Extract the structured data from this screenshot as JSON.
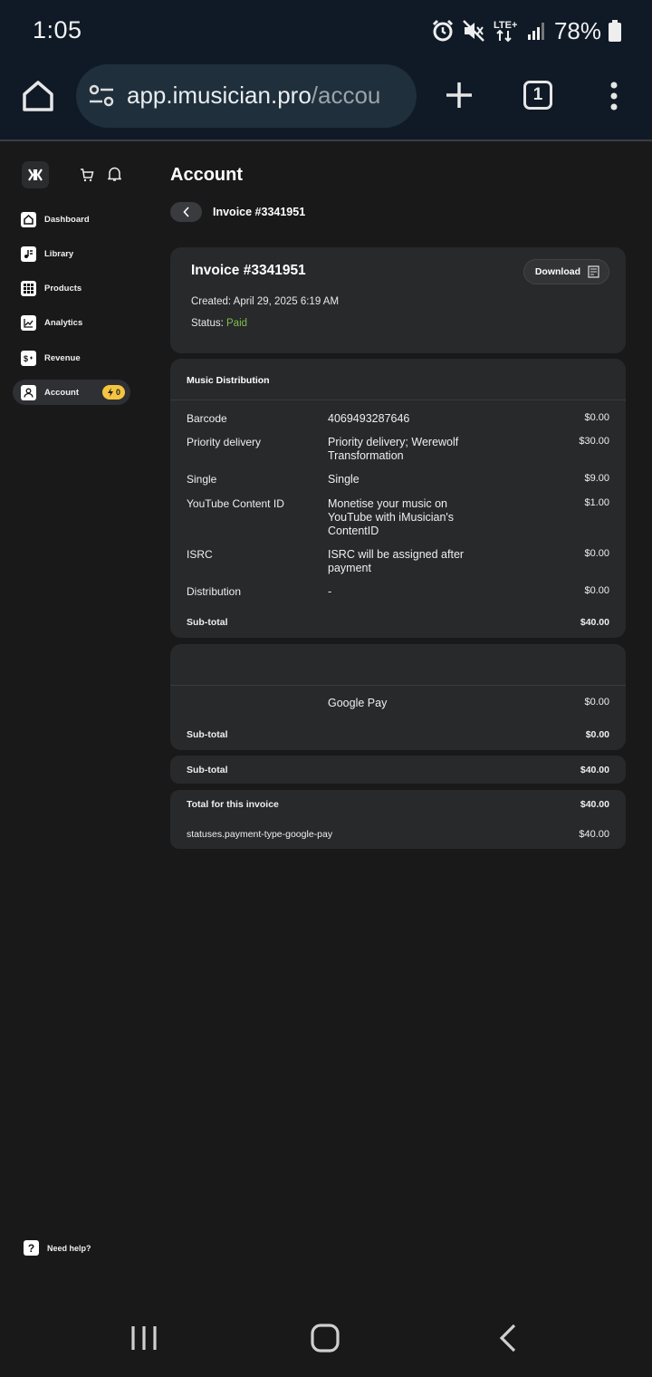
{
  "status_bar": {
    "time": "1:05",
    "network": "LTE+",
    "battery": "78%"
  },
  "browser": {
    "url_main": "app.imusician.pro",
    "url_rest": "/accou",
    "tab_count": "1"
  },
  "sidebar": {
    "items": [
      {
        "label": "Dashboard",
        "icon": "home-icon"
      },
      {
        "label": "Library",
        "icon": "library-icon"
      },
      {
        "label": "Products",
        "icon": "grid-icon"
      },
      {
        "label": "Analytics",
        "icon": "chart-icon"
      },
      {
        "label": "Revenue",
        "icon": "dollar-icon"
      },
      {
        "label": "Account",
        "icon": "user-icon",
        "active": true,
        "badge": "0"
      }
    ],
    "help": "Need help?"
  },
  "main": {
    "title": "Account",
    "breadcrumb": "Invoice #3341951",
    "invoice": {
      "title": "Invoice #3341951",
      "download_label": "Download",
      "created_label": "Created:",
      "created_value": "April 29, 2025 6:19 AM",
      "status_label": "Status:",
      "status_value": "Paid"
    },
    "music_distribution": {
      "heading": "Music Distribution",
      "rows": [
        {
          "name": "Barcode",
          "desc": "4069493287646",
          "price": "$0.00"
        },
        {
          "name": "Priority delivery",
          "desc": "Priority delivery; Werewolf Transformation",
          "price": "$30.00"
        },
        {
          "name": "Single",
          "desc": "Single",
          "price": "$9.00"
        },
        {
          "name": "YouTube Content ID",
          "desc": "Monetise your music on YouTube with iMusician's ContentID",
          "price": "$1.00"
        },
        {
          "name": "ISRC",
          "desc": "ISRC will be assigned after payment",
          "price": "$0.00"
        },
        {
          "name": "Distribution",
          "desc": "-",
          "price": "$0.00"
        }
      ],
      "subtotal_label": "Sub-total",
      "subtotal_value": "$40.00"
    },
    "payment": {
      "desc": "Google Pay",
      "price": "$0.00",
      "subtotal_label": "Sub-total",
      "subtotal_value": "$0.00"
    },
    "overall_subtotal": {
      "label": "Sub-total",
      "value": "$40.00"
    },
    "totals": {
      "total_label": "Total for this invoice",
      "total_value": "$40.00",
      "payment_type_label": "statuses.payment-type-google-pay",
      "payment_type_value": "$40.00"
    }
  },
  "colors": {
    "background": "#19191a",
    "card": "#28292b",
    "paid": "#7cbf4a",
    "badge": "#f5c542",
    "browser_bar": "#101a26"
  }
}
